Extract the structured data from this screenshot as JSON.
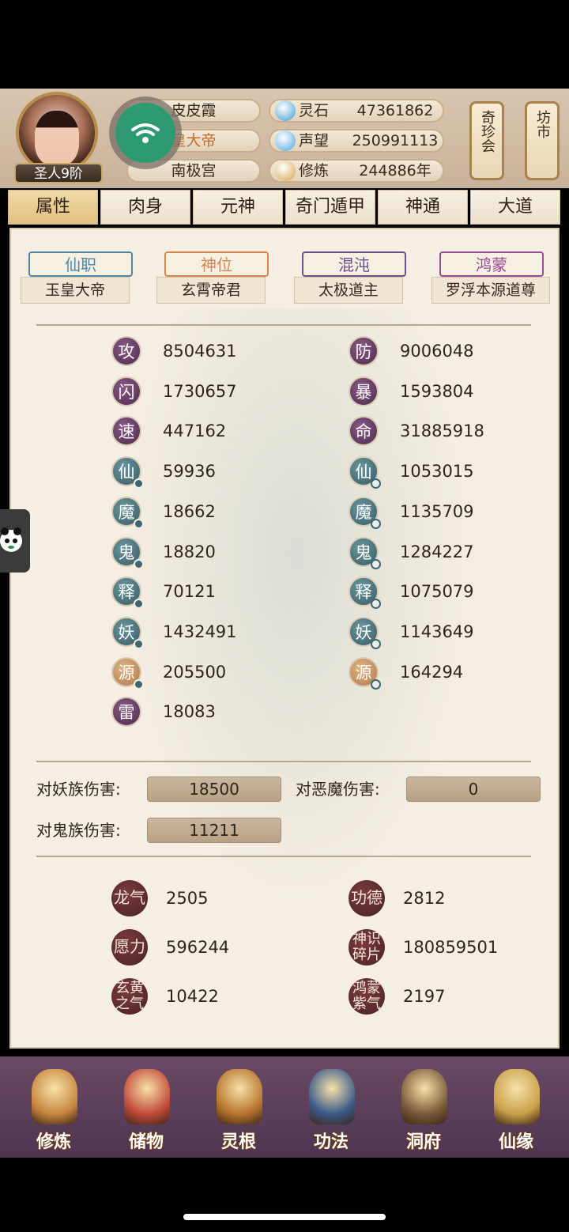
{
  "player": {
    "rank": "圣人9阶",
    "name": "皮皮霞",
    "title": "皇大帝",
    "sect": "南极宫"
  },
  "resources": [
    {
      "icon": "spirit-stone-icon",
      "label": "灵石",
      "value": "47361862"
    },
    {
      "icon": "reputation-icon",
      "label": "声望",
      "value": "250991113"
    },
    {
      "icon": "cultivation-icon",
      "label": "修炼",
      "value": "244886年"
    }
  ],
  "side_buttons": {
    "treasure": "奇珍会",
    "market": "坊市"
  },
  "tabs": [
    "属性",
    "肉身",
    "元神",
    "奇门遁甲",
    "神通",
    "大道"
  ],
  "active_tab": 0,
  "titles": [
    {
      "badge": "仙职",
      "value": "玉皇大帝",
      "color": "#4f87a3"
    },
    {
      "badge": "神位",
      "value": "玄霄帝君",
      "color": "#d9834a"
    },
    {
      "badge": "混沌",
      "value": "太极道主",
      "color": "#6b4f8a"
    },
    {
      "badge": "鸿蒙",
      "value": "罗浮本源道尊",
      "color": "#9a4a96"
    }
  ],
  "stats_left": [
    {
      "icon": "攻",
      "value": "8504631",
      "style": "purple",
      "dot": ""
    },
    {
      "icon": "闪",
      "value": "1730657",
      "style": "purple",
      "dot": ""
    },
    {
      "icon": "速",
      "value": "447162",
      "style": "purple",
      "dot": ""
    },
    {
      "icon": "仙",
      "value": "59936",
      "style": "teal",
      "dot": "solid"
    },
    {
      "icon": "魔",
      "value": "18662",
      "style": "teal",
      "dot": "solid"
    },
    {
      "icon": "鬼",
      "value": "18820",
      "style": "teal",
      "dot": "solid"
    },
    {
      "icon": "释",
      "value": "70121",
      "style": "teal",
      "dot": "solid"
    },
    {
      "icon": "妖",
      "value": "1432491",
      "style": "teal",
      "dot": "solid"
    },
    {
      "icon": "源",
      "value": "205500",
      "style": "orange",
      "dot": "solid"
    },
    {
      "icon": "雷",
      "value": "18083",
      "style": "purple",
      "dot": ""
    }
  ],
  "stats_right": [
    {
      "icon": "防",
      "value": "9006048",
      "style": "purple",
      "dot": ""
    },
    {
      "icon": "暴",
      "value": "1593804",
      "style": "purple",
      "dot": ""
    },
    {
      "icon": "命",
      "value": "31885918",
      "style": "purple",
      "dot": ""
    },
    {
      "icon": "仙",
      "value": "1053015",
      "style": "teal",
      "dot": "ring"
    },
    {
      "icon": "魔",
      "value": "1135709",
      "style": "teal",
      "dot": "ring"
    },
    {
      "icon": "鬼",
      "value": "1284227",
      "style": "teal",
      "dot": "ring"
    },
    {
      "icon": "释",
      "value": "1075079",
      "style": "teal",
      "dot": "ring"
    },
    {
      "icon": "妖",
      "value": "1143649",
      "style": "teal",
      "dot": "ring"
    },
    {
      "icon": "源",
      "value": "164294",
      "style": "orange",
      "dot": "ring"
    }
  ],
  "damage": {
    "demon_label": "对妖族伤害:",
    "demon_value": "18500",
    "evil_label": "对恶魔伤害:",
    "evil_value": "0",
    "ghost_label": "对鬼族伤害:",
    "ghost_value": "11211"
  },
  "extra_resources": [
    {
      "icon": "龙气",
      "value": "2505"
    },
    {
      "icon": "功德",
      "value": "2812"
    },
    {
      "icon": "愿力",
      "value": "596244"
    },
    {
      "icon": "神识碎片",
      "value": "180859501"
    },
    {
      "icon": "玄黄之气",
      "value": "10422"
    },
    {
      "icon": "鸿蒙紫气",
      "value": "2197"
    }
  ],
  "nav": [
    "修炼",
    "储物",
    "灵根",
    "功法",
    "洞府",
    "仙缘"
  ],
  "colors": {
    "accent": "#e2c083",
    "panel": "#f4efe2",
    "nav": "#5a3f5a"
  }
}
